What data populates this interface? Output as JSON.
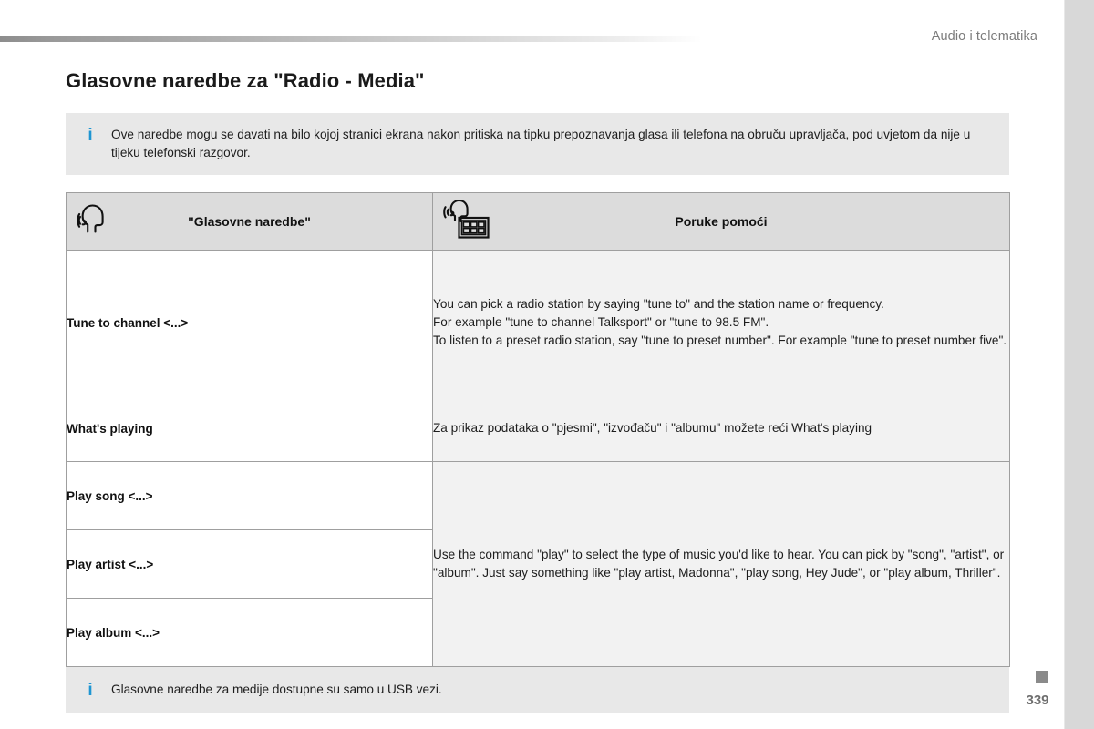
{
  "header": {
    "title": "Audio i telematika"
  },
  "page": {
    "title": "Glasovne naredbe za \"Radio - Media\"",
    "number": "339"
  },
  "notes": {
    "top": {
      "icon": "info-icon",
      "text": "Ove naredbe mogu se davati na bilo kojoj stranici ekrana nakon pritiska na tipku prepoznavanja glasa ili telefona na obruču upravljača, pod uvjetom da nije u tijeku telefonski razgovor."
    },
    "bottom": {
      "icon": "info-icon",
      "text": "Glasovne naredbe za medije dostupne su samo u USB vezi."
    }
  },
  "table": {
    "headers": [
      {
        "icon": "voice-command-head-icon",
        "label": "\"Glasovne naredbe\""
      },
      {
        "icon": "voice-help-screen-icon",
        "label": "Poruke pomoći"
      }
    ],
    "rows": [
      {
        "command": "Tune to channel <...>",
        "help_lines": [
          "You can pick a radio station by saying \"tune to\" and the station name or frequency.",
          "For example \"tune to channel Talksport\" or \"tune to 98.5 FM\".",
          "To listen to a preset radio station, say \"tune to preset number\". For example \"tune to preset number five\"."
        ]
      },
      {
        "command": "What's playing",
        "help_lines": [
          "Za prikaz podataka o \"pjesmi\", \"izvođaču\" i \"albumu\" možete reći What's playing"
        ]
      },
      {
        "command": "Play song <...>",
        "help_lines": []
      },
      {
        "command": "Play artist <...>",
        "help_lines": [
          "Use the command \"play\" to select the type of music you'd like to hear. You can pick by \"song\", \"artist\", or \"album\". Just say something like \"play artist, Madonna\", \"play song, Hey Jude\", or \"play album, Thriller\"."
        ]
      },
      {
        "command": "Play album <...>",
        "help_lines": []
      }
    ]
  },
  "colors": {
    "accent_info": "#1f96d2",
    "note_background": "#e8e8e8",
    "table_header_background": "#dcdcdc",
    "help_cell_background": "#f2f2f2",
    "table_border": "#9f9f9f",
    "right_strip": "#d8d8d8"
  }
}
